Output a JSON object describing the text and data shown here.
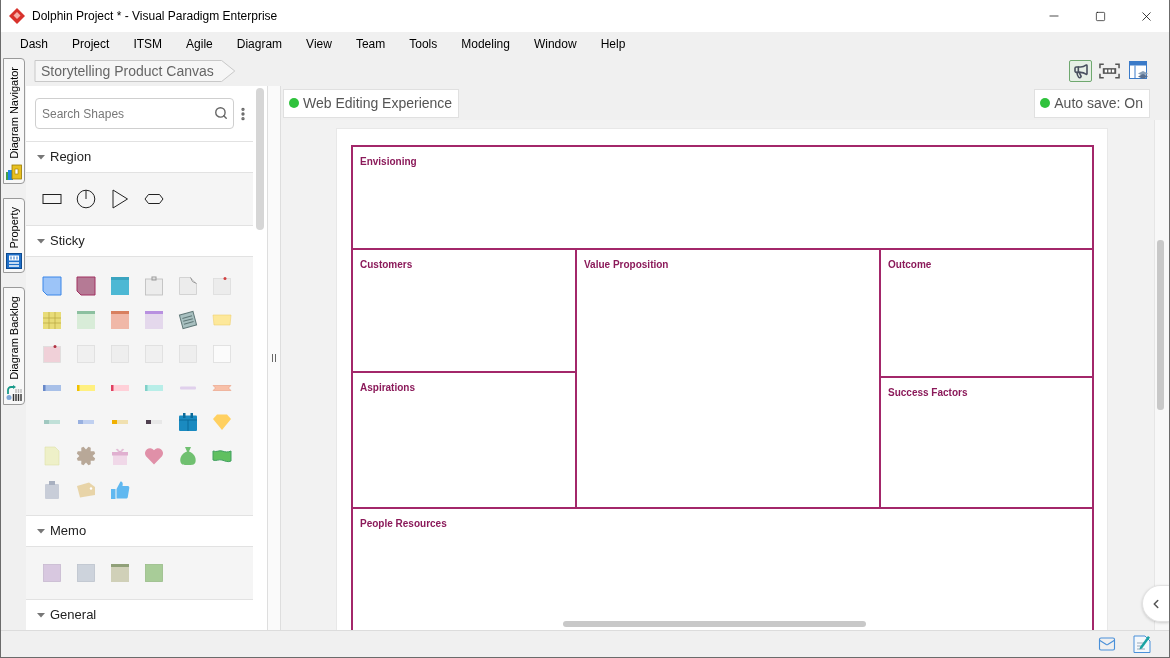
{
  "window": {
    "title": "Dolphin Project * - Visual Paradigm Enterprise"
  },
  "menu_bar": [
    "Dash",
    "Project",
    "ITSM",
    "Agile",
    "Diagram",
    "View",
    "Team",
    "Tools",
    "Modeling",
    "Window",
    "Help"
  ],
  "side_tabs": [
    "Diagram Navigator",
    "Property",
    "Diagram Backlog"
  ],
  "breadcrumb": [
    "Storytelling Product Canvas"
  ],
  "toolbar": [
    {
      "selected": true
    },
    {
      "selected": false
    },
    {
      "selected": false
    }
  ],
  "palette": {
    "search": {
      "placeholder": "Search Shapes"
    },
    "sections": [
      {
        "title": "Region",
        "expanded": true
      },
      {
        "title": "Sticky",
        "expanded": true
      },
      {
        "title": "Memo",
        "expanded": true
      },
      {
        "title": "General",
        "expanded": true
      }
    ]
  },
  "canvas": {
    "view_tab": "Web Editing Experience",
    "auto_save": "Auto save: On",
    "regions": [
      "Envisioning",
      "Customers",
      "Value Proposition",
      "Outcome",
      "Aspirations",
      "Success Factors",
      "People Resources"
    ]
  }
}
